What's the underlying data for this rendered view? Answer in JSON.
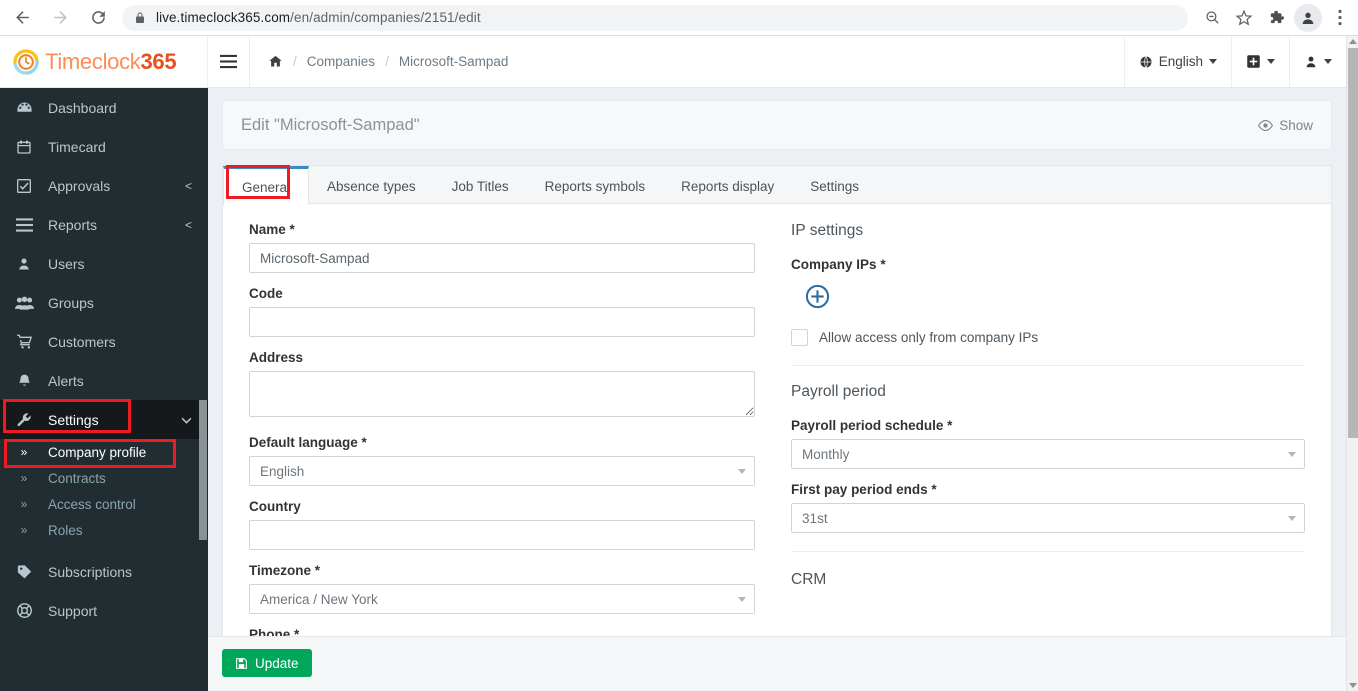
{
  "browser": {
    "url_host": "live.timeclock365.com",
    "url_path": "/en/admin/companies/2151/edit",
    "back_icon": "back-arrow-icon",
    "forward_icon": "forward-arrow-icon",
    "reload_icon": "reload-icon",
    "lock_icon": "lock-icon",
    "zoom_out_icon": "zoom-out-icon",
    "bookmark_icon": "star-icon",
    "extensions_icon": "puzzle-piece-icon",
    "profile_icon": "user-avatar-icon",
    "menu_icon": "three-dot-menu-icon"
  },
  "header": {
    "logo_text_light": "Timeclock",
    "logo_text_bold": "365",
    "hamburger_icon": "hamburger-menu-icon",
    "breadcrumb": {
      "home_icon": "home-icon",
      "separator": "/",
      "items": [
        "Companies",
        "Microsoft-Sampad"
      ]
    },
    "language": {
      "icon": "globe-icon",
      "label": "English"
    },
    "add_menu_icon": "plus-square-icon",
    "user_menu_icon": "user-icon"
  },
  "sidebar": {
    "items": [
      {
        "label": "Dashboard",
        "icon": "dashboard-gauge-icon",
        "arrow": ""
      },
      {
        "label": "Timecard",
        "icon": "calendar-icon",
        "arrow": ""
      },
      {
        "label": "Approvals",
        "icon": "check-square-icon",
        "arrow": "<"
      },
      {
        "label": "Reports",
        "icon": "list-bars-icon",
        "arrow": "<"
      },
      {
        "label": "Users",
        "icon": "user-icon",
        "arrow": ""
      },
      {
        "label": "Groups",
        "icon": "users-group-icon",
        "arrow": ""
      },
      {
        "label": "Customers",
        "icon": "shopping-cart-icon",
        "arrow": ""
      },
      {
        "label": "Alerts",
        "icon": "bell-icon",
        "arrow": ""
      },
      {
        "label": "Settings",
        "icon": "wrench-icon",
        "arrow": "v"
      }
    ],
    "settings_children": [
      {
        "label": "Company profile",
        "icon": "double-chevron-right-icon",
        "active": true
      },
      {
        "label": "Contracts",
        "icon": "double-chevron-right-icon",
        "active": false
      },
      {
        "label": "Access control",
        "icon": "double-chevron-right-icon",
        "active": false
      },
      {
        "label": "Roles",
        "icon": "double-chevron-right-icon",
        "active": false
      }
    ],
    "tail_items": [
      {
        "label": "Subscriptions",
        "icon": "tag-icon"
      },
      {
        "label": "Support",
        "icon": "lifebuoy-icon"
      }
    ]
  },
  "page": {
    "title": "Edit \"Microsoft-Sampad\"",
    "show_label": "Show",
    "show_icon": "eye-icon"
  },
  "tabs": [
    {
      "label": "General",
      "active": true
    },
    {
      "label": "Absence types",
      "active": false
    },
    {
      "label": "Job Titles",
      "active": false
    },
    {
      "label": "Reports symbols",
      "active": false
    },
    {
      "label": "Reports display",
      "active": false
    },
    {
      "label": "Settings",
      "active": false
    }
  ],
  "form_left": {
    "name": {
      "label": "Name *",
      "value": "Microsoft-Sampad",
      "placeholder": ""
    },
    "code": {
      "label": "Code",
      "value": "",
      "placeholder": ""
    },
    "address": {
      "label": "Address",
      "value": "",
      "placeholder": ""
    },
    "language": {
      "label": "Default language *",
      "value": "English"
    },
    "country": {
      "label": "Country",
      "value": "",
      "placeholder": ""
    },
    "timezone": {
      "label": "Timezone *",
      "value": "America / New York"
    },
    "phone": {
      "label": "Phone *"
    }
  },
  "form_right": {
    "ip_section_title": "IP settings",
    "company_ips_label": "Company IPs *",
    "add_ip_icon": "circle-plus-icon",
    "allow_only_label": "Allow access only from company IPs",
    "allow_only_checked": false,
    "payroll_section_title": "Payroll period",
    "payroll_schedule": {
      "label": "Payroll period schedule *",
      "value": "Monthly"
    },
    "first_pay_end": {
      "label": "First pay period ends *",
      "value": "31st"
    },
    "crm_section_title": "CRM"
  },
  "footer": {
    "update_label": "Update",
    "update_icon": "floppy-save-icon",
    "update_color": "#00a65a"
  },
  "colors": {
    "sidebar_bg": "#222d32",
    "content_bg": "#ecf0f5",
    "tab_accent": "#3c8dbc",
    "annotation": "#ee1b24",
    "logo_orange": "#e8501b"
  }
}
